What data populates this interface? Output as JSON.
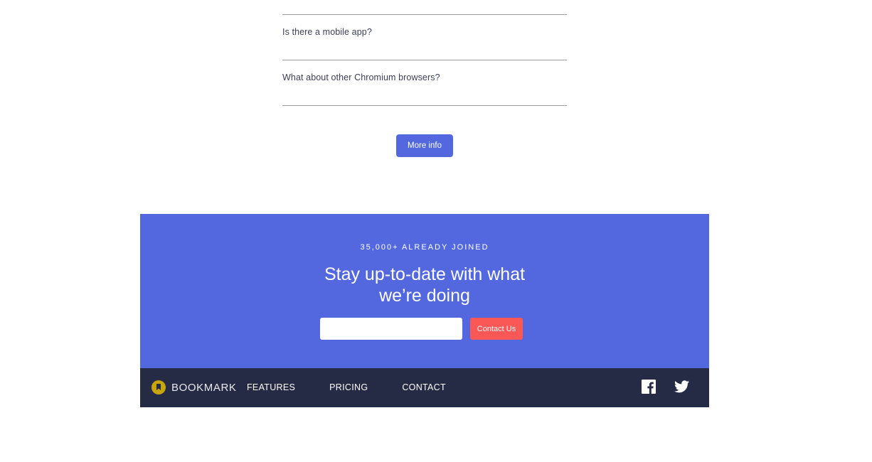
{
  "faq": {
    "items": [
      {
        "question": "Is there a mobile app?"
      },
      {
        "question": "What about other Chromium browsers?"
      }
    ],
    "more_info_label": "More info"
  },
  "cta": {
    "kicker": "35,000+ ALREADY JOINED",
    "heading_line1": "Stay up-to-date with what",
    "heading_line2": "we’re doing",
    "email_value": "",
    "contact_label": "Contact Us"
  },
  "footer": {
    "logo_text": "BOOKMARK",
    "nav": [
      "FEATURES",
      "PRICING",
      "CONTACT"
    ],
    "social_icons": [
      "facebook-icon",
      "twitter-icon"
    ]
  },
  "colors": {
    "primary_blue": "#5368df",
    "soft_red": "#fa5757",
    "dark_navy": "#252a45",
    "logo_gold": "#c9a50c"
  }
}
